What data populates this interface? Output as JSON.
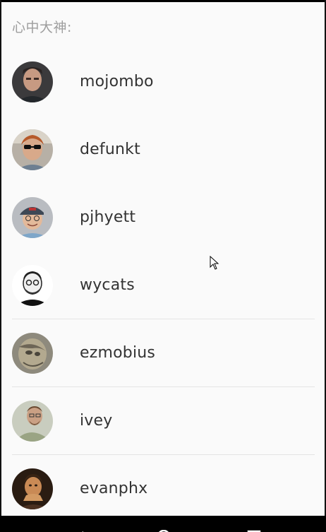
{
  "header": {
    "title": "心中大神:"
  },
  "users": [
    {
      "name": "mojombo"
    },
    {
      "name": "defunkt"
    },
    {
      "name": "pjhyett"
    },
    {
      "name": "wycats"
    },
    {
      "name": "ezmobius"
    },
    {
      "name": "ivey"
    },
    {
      "name": "evanphx"
    }
  ],
  "navbar": {
    "back_icon": "back-triangle-icon",
    "home_icon": "home-circle-icon",
    "recents_icon": "recents-square-icon"
  }
}
